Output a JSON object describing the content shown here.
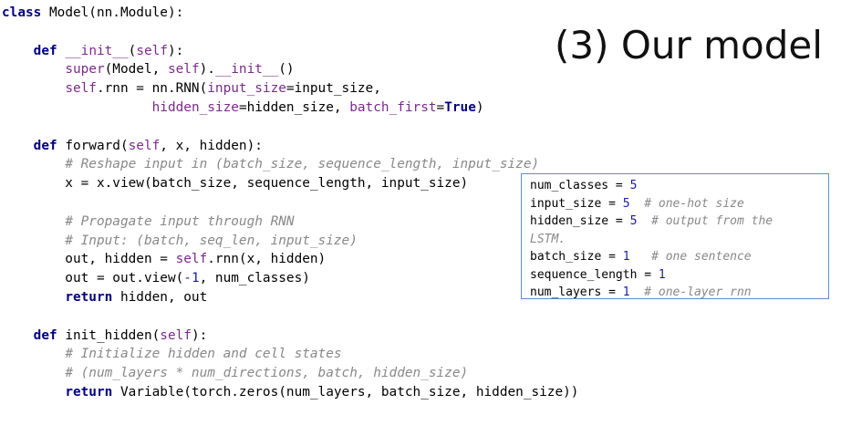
{
  "slide": {
    "title": "(3) Our model"
  },
  "code_lines": [
    [
      {
        "t": "class",
        "s": "kw"
      },
      {
        "t": " Model(nn.Module):",
        "s": ""
      }
    ],
    [],
    [
      {
        "t": "    ",
        "s": ""
      },
      {
        "t": "def",
        "s": "kw"
      },
      {
        "t": " ",
        "s": ""
      },
      {
        "t": "__init__",
        "s": "mg"
      },
      {
        "t": "(",
        "s": ""
      },
      {
        "t": "self",
        "s": "mg"
      },
      {
        "t": "):",
        "s": ""
      }
    ],
    [
      {
        "t": "        ",
        "s": ""
      },
      {
        "t": "super",
        "s": "mg"
      },
      {
        "t": "(Model, ",
        "s": ""
      },
      {
        "t": "self",
        "s": "mg"
      },
      {
        "t": ").",
        "s": ""
      },
      {
        "t": "__init__",
        "s": "mg"
      },
      {
        "t": "()",
        "s": ""
      }
    ],
    [
      {
        "t": "        ",
        "s": ""
      },
      {
        "t": "self",
        "s": "mg"
      },
      {
        "t": ".rnn = nn.RNN(",
        "s": ""
      },
      {
        "t": "input_size",
        "s": "mg"
      },
      {
        "t": "=input_size,",
        "s": ""
      }
    ],
    [
      {
        "t": "                   ",
        "s": ""
      },
      {
        "t": "hidden_size",
        "s": "mg"
      },
      {
        "t": "=hidden_size, ",
        "s": ""
      },
      {
        "t": "batch_first",
        "s": "mg"
      },
      {
        "t": "=",
        "s": ""
      },
      {
        "t": "True",
        "s": "kw"
      },
      {
        "t": ")",
        "s": ""
      }
    ],
    [],
    [
      {
        "t": "    ",
        "s": ""
      },
      {
        "t": "def",
        "s": "kw"
      },
      {
        "t": " forward(",
        "s": ""
      },
      {
        "t": "self",
        "s": "mg"
      },
      {
        "t": ", x, hidden):",
        "s": ""
      }
    ],
    [
      {
        "t": "        ",
        "s": ""
      },
      {
        "t": "# Reshape input in (batch_size, sequence_length, input_size)",
        "s": "cm"
      }
    ],
    [
      {
        "t": "        x = x.view(batch_size, sequence_length, input_size)",
        "s": ""
      }
    ],
    [],
    [
      {
        "t": "        ",
        "s": ""
      },
      {
        "t": "# Propagate input through RNN",
        "s": "cm"
      }
    ],
    [
      {
        "t": "        ",
        "s": ""
      },
      {
        "t": "# Input: (batch, seq_len, input_size)",
        "s": "cm"
      }
    ],
    [
      {
        "t": "        out, hidden = ",
        "s": ""
      },
      {
        "t": "self",
        "s": "mg"
      },
      {
        "t": ".rnn(x, hidden)",
        "s": ""
      }
    ],
    [
      {
        "t": "        out = out.view(",
        "s": ""
      },
      {
        "t": "-1",
        "s": "nm"
      },
      {
        "t": ", num_classes)",
        "s": ""
      }
    ],
    [
      {
        "t": "        ",
        "s": ""
      },
      {
        "t": "return",
        "s": "kw"
      },
      {
        "t": " hidden, out",
        "s": ""
      }
    ],
    [],
    [
      {
        "t": "    ",
        "s": ""
      },
      {
        "t": "def",
        "s": "kw"
      },
      {
        "t": " init_hidden(",
        "s": ""
      },
      {
        "t": "self",
        "s": "mg"
      },
      {
        "t": "):",
        "s": ""
      }
    ],
    [
      {
        "t": "        ",
        "s": ""
      },
      {
        "t": "# Initialize hidden and cell states",
        "s": "cm"
      }
    ],
    [
      {
        "t": "        ",
        "s": ""
      },
      {
        "t": "# (num_layers * num_directions, batch, hidden_size)",
        "s": "cm"
      }
    ],
    [
      {
        "t": "        ",
        "s": ""
      },
      {
        "t": "return",
        "s": "kw"
      },
      {
        "t": " Variable(torch.zeros(num_layers, batch_size, hidden_size))",
        "s": ""
      }
    ]
  ],
  "config_lines": [
    [
      {
        "t": "num_classes = ",
        "s": ""
      },
      {
        "t": "5",
        "s": "nm"
      }
    ],
    [
      {
        "t": "input_size = ",
        "s": ""
      },
      {
        "t": "5",
        "s": "nm"
      },
      {
        "t": "  ",
        "s": ""
      },
      {
        "t": "# one-hot size",
        "s": "cm"
      }
    ],
    [
      {
        "t": "hidden_size = ",
        "s": ""
      },
      {
        "t": "5",
        "s": "nm"
      },
      {
        "t": "  ",
        "s": ""
      },
      {
        "t": "# output from the",
        "s": "cm"
      }
    ],
    [
      {
        "t": "LSTM.",
        "s": "cm"
      }
    ],
    [
      {
        "t": "batch_size = ",
        "s": ""
      },
      {
        "t": "1",
        "s": "nm"
      },
      {
        "t": "   ",
        "s": ""
      },
      {
        "t": "# one sentence",
        "s": "cm"
      }
    ],
    [
      {
        "t": "sequence_length = ",
        "s": ""
      },
      {
        "t": "1",
        "s": "nm"
      }
    ],
    [
      {
        "t": "num_layers = ",
        "s": ""
      },
      {
        "t": "1",
        "s": "nm"
      },
      {
        "t": "  ",
        "s": ""
      },
      {
        "t": "# one-layer rnn",
        "s": "cm"
      }
    ]
  ],
  "colors": {
    "keyword": "#000080",
    "magic": "#7a2b8a",
    "number": "#1a1aa6",
    "comment": "#888888",
    "box_border": "#5a8fc4"
  }
}
